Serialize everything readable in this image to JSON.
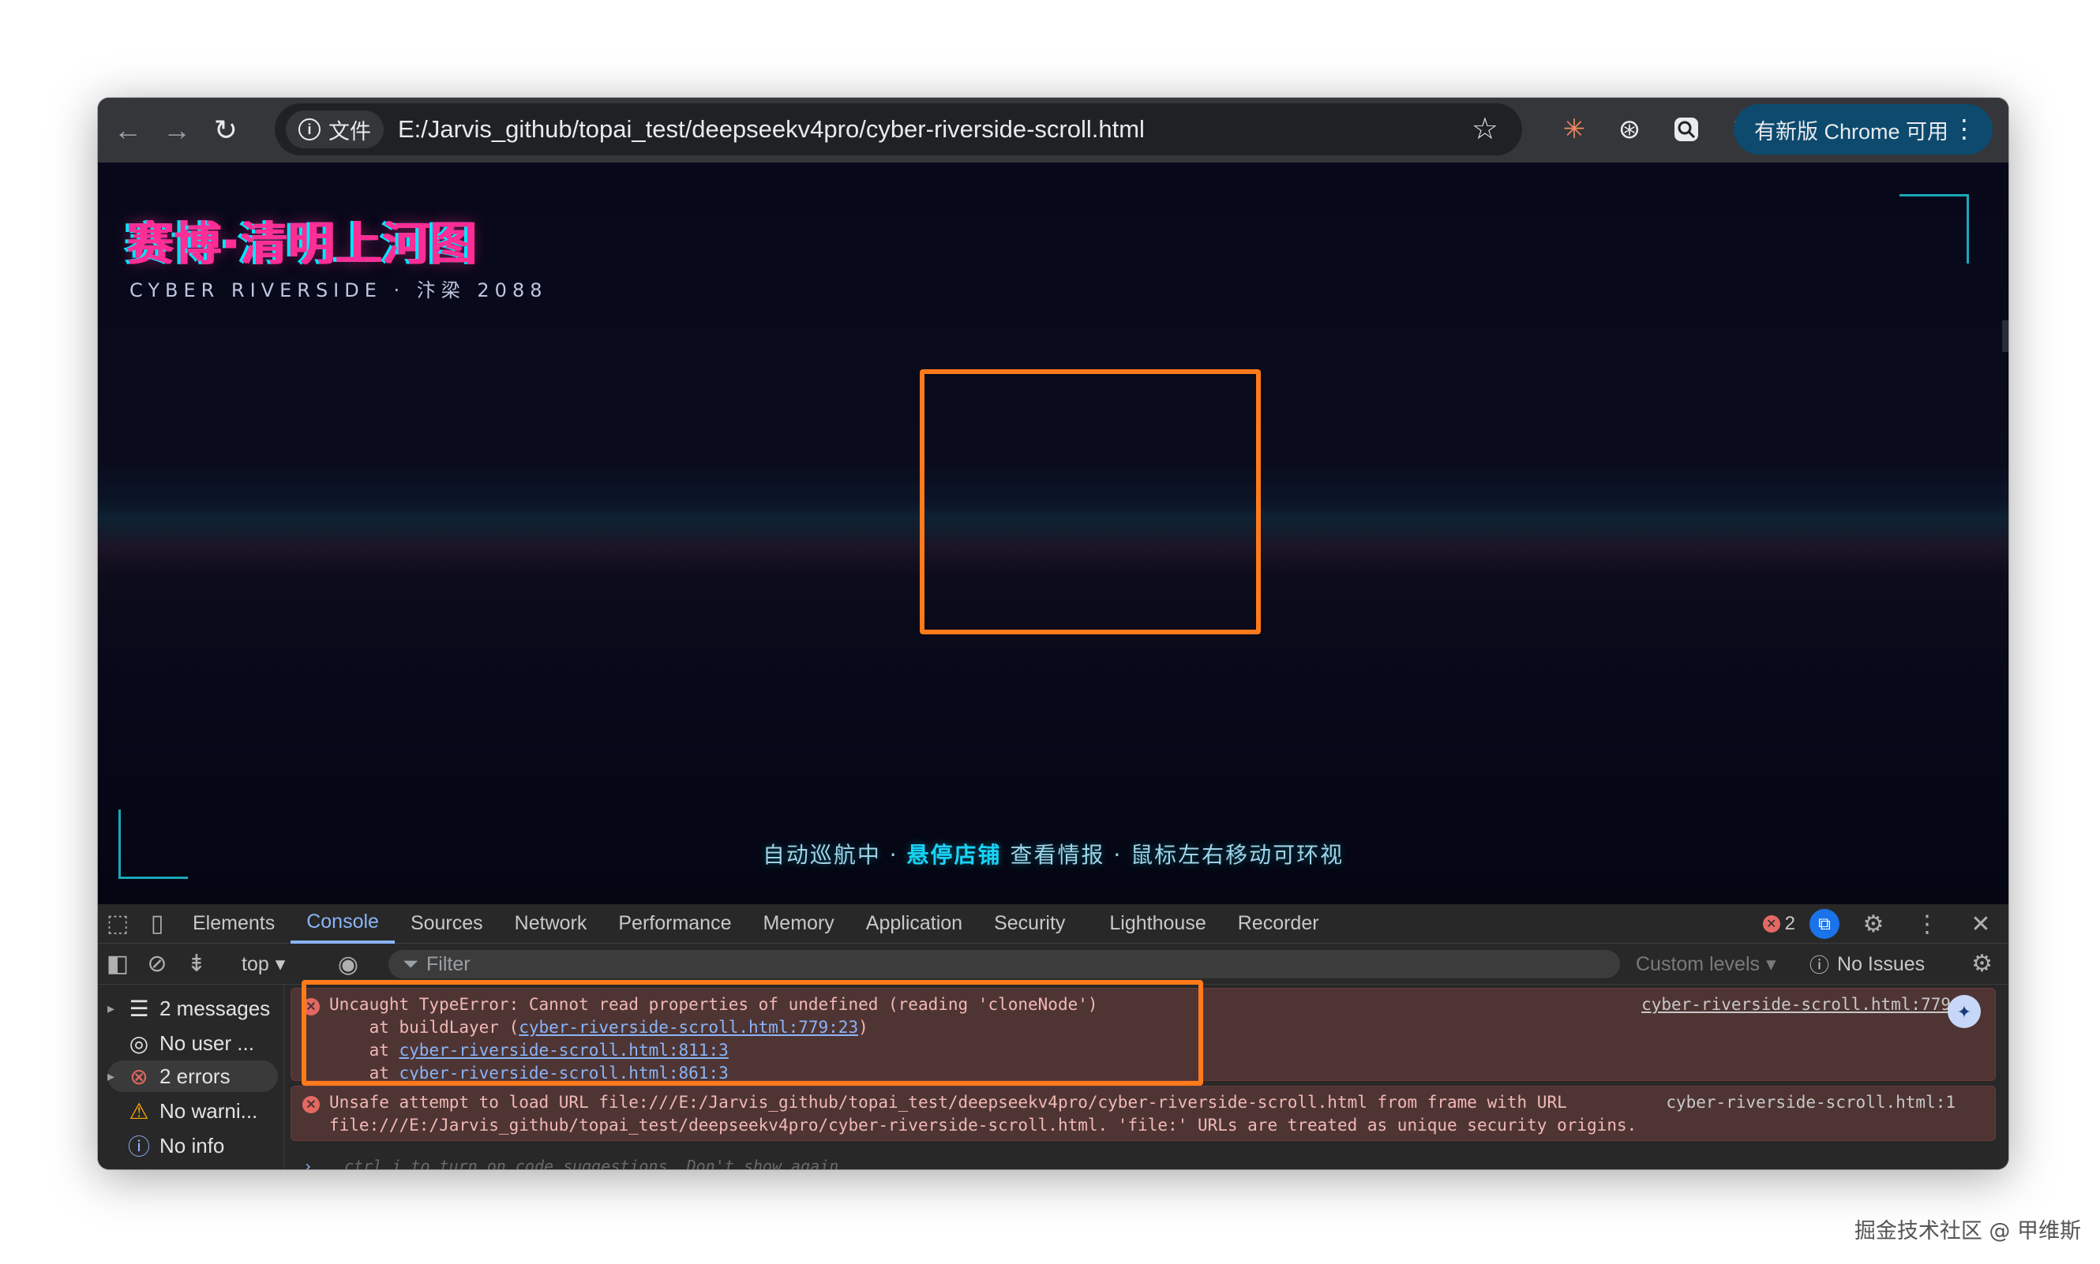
{
  "browser": {
    "site_chip": "文件",
    "url": "E:/Jarvis_github/topai_test/deepseekv4pro/cyber-riverside-scroll.html",
    "update_label": "有新版 Chrome 可用"
  },
  "page": {
    "title": "赛博·清明上河图",
    "subtitle": "CYBER RIVERSIDE · 汴梁 2088",
    "hint_part1": "自动巡航中 · ",
    "hint_highlight": "悬停店铺",
    "hint_part2": " 查看情报 · 鼠标左右移动可环视"
  },
  "devtools": {
    "tabs": [
      "Elements",
      "Console",
      "Sources",
      "Network",
      "Performance",
      "Memory",
      "Application",
      "Security",
      "Lighthouse",
      "Recorder"
    ],
    "active_tab": "Console",
    "error_count": "2",
    "context": "top",
    "filter_placeholder": "Filter",
    "custom_levels": "Custom levels",
    "no_issues": "No Issues",
    "sidebar": [
      {
        "label": "2 messages",
        "icon": "list-icon"
      },
      {
        "label": "No user ...",
        "icon": "user-icon"
      },
      {
        "label": "2 errors",
        "icon": "error-icon"
      },
      {
        "label": "No warni...",
        "icon": "warning-icon"
      },
      {
        "label": "No info",
        "icon": "info-icon"
      }
    ],
    "messages": [
      {
        "line1": "Uncaught TypeError: Cannot read properties of undefined (reading 'cloneNode')",
        "line2_prefix": "    at buildLayer (",
        "line2_link": "cyber-riverside-scroll.html:779:23",
        "line2_suffix": ")",
        "line3_prefix": "    at ",
        "line3_link": "cyber-riverside-scroll.html:811:3",
        "line4_prefix": "    at ",
        "line4_link": "cyber-riverside-scroll.html:861:3",
        "source": "cyber-riverside-scroll.html:779"
      },
      {
        "line1": "Unsafe attempt to load URL file:///E:/Jarvis_github/topai_test/deepseekv4pro/cyber-riverside-scroll.html from frame with URL",
        "line2": "file:///E:/Jarvis_github/topai_test/deepseekv4pro/cyber-riverside-scroll.html. 'file:' URLs are treated as unique security origins.",
        "source": "cyber-riverside-scroll.html:1"
      }
    ],
    "prompt_key1": "ctrl",
    "prompt_key2": "i",
    "prompt_hint": "to turn on code suggestions. Don't show again"
  },
  "watermark": "掘金技术社区 @ 甲维斯"
}
